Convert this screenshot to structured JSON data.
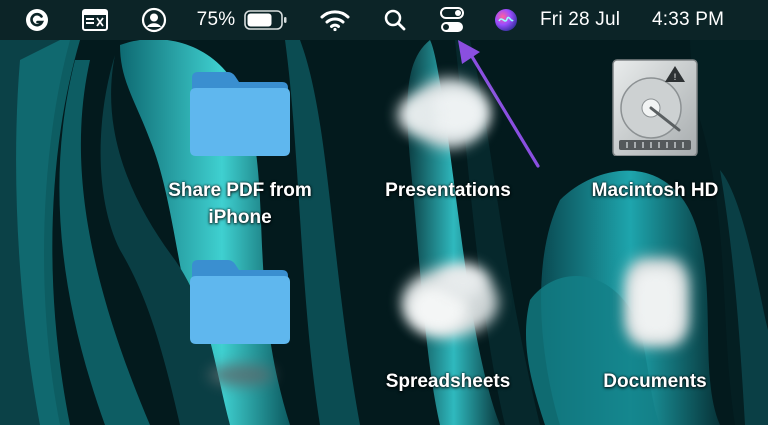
{
  "menubar": {
    "icons": [
      "grammarly-icon",
      "window-preview-icon",
      "user-account-icon",
      "battery-icon",
      "wifi-icon",
      "spotlight-search-icon",
      "control-center-icon",
      "siri-icon"
    ],
    "battery_percent": "75%",
    "battery_level": 0.75,
    "date": "Fri 28 Jul",
    "time": "4:33 PM"
  },
  "desktop": {
    "items": [
      {
        "label": "Share PDF from iPhone",
        "icon": "folder-icon"
      },
      {
        "label": "Presentations",
        "icon": "stack-icon"
      },
      {
        "label": "Macintosh HD",
        "icon": "hard-drive-icon"
      },
      {
        "label": "",
        "icon": "folder-icon"
      },
      {
        "label": "Spreadsheets",
        "icon": "stack-icon"
      },
      {
        "label": "Documents",
        "icon": "stack-icon"
      }
    ]
  },
  "annotation": {
    "icon": "arrow-annotation-icon",
    "color": "#8a4fe0"
  },
  "colors": {
    "menubar": "#0c2427",
    "folder": "#5fb7ee",
    "accent_teal": "#1fb8c2"
  }
}
